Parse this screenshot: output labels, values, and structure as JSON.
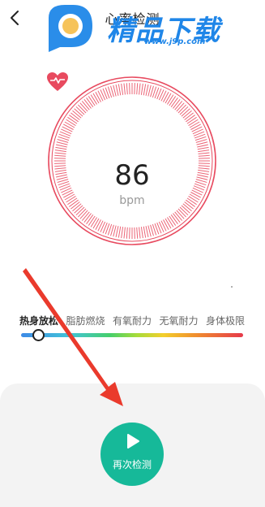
{
  "header": {
    "title": "心率检测",
    "back_icon": "chevron-left-icon"
  },
  "watermark": {
    "brand_text": "精品下载",
    "url": "www.j9p.com"
  },
  "gauge": {
    "heart_icon": "heart-pulse-icon",
    "bpm_value": "86",
    "bpm_unit": "bpm",
    "accent_color": "#e84a5f"
  },
  "zones": {
    "labels": [
      "热身放松",
      "脂肪燃烧",
      "有氧耐力",
      "无氧耐力",
      "身体极限"
    ],
    "current_index": 0
  },
  "actions": {
    "redetect_label": "再次检测",
    "play_icon": "play-icon",
    "button_color": "#16b999"
  },
  "annotation": {
    "arrow_color": "#ea3a2c",
    "arrow_icon": "red-arrow-pointer"
  }
}
